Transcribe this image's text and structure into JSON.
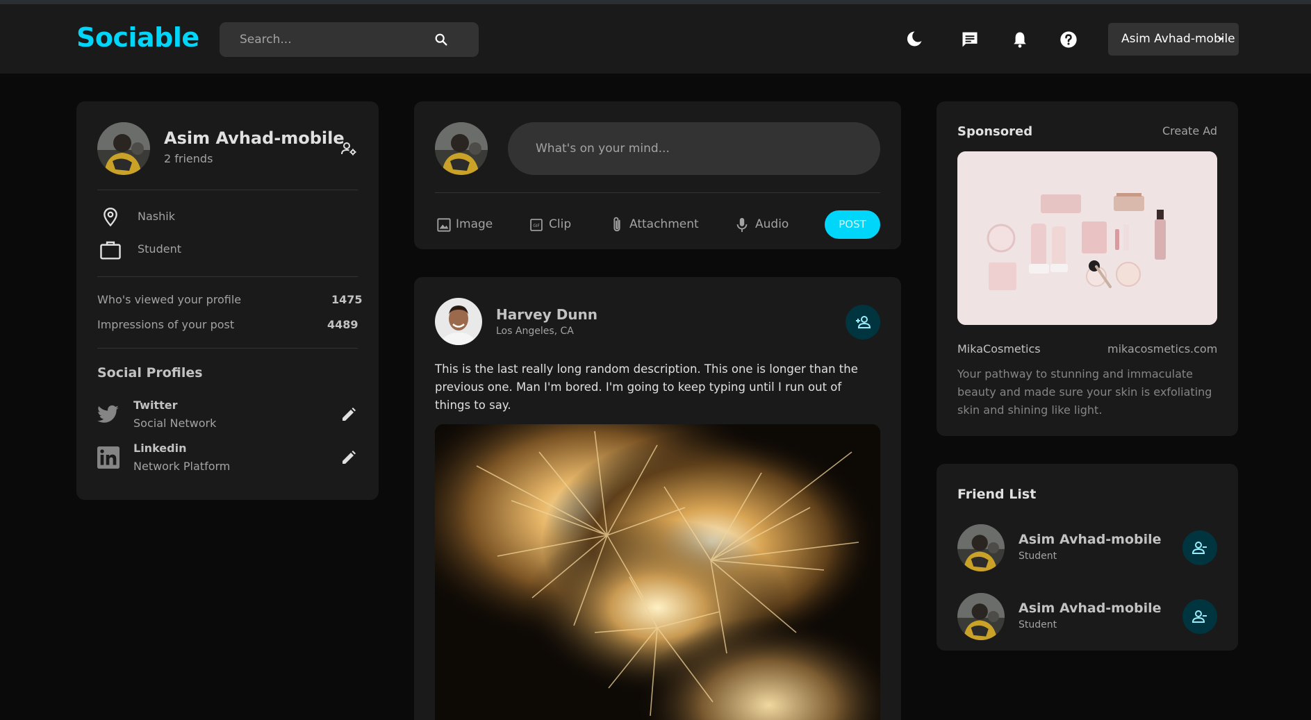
{
  "navbar": {
    "logo": "Sociable",
    "search_placeholder": "Search...",
    "user_name": "Asim Avhad-mobile",
    "icons": [
      "moon-icon",
      "message-icon",
      "bell-icon",
      "help-icon"
    ]
  },
  "profile": {
    "name": "Asim Avhad-mobile",
    "friends": "2 friends",
    "location": "Nashik",
    "occupation": "Student",
    "viewed_label": "Who's viewed your profile",
    "viewed_value": "1475",
    "impressions_label": "Impressions of your post",
    "impressions_value": "4489",
    "social_title": "Social Profiles",
    "socials": [
      {
        "name": "Twitter",
        "desc": "Social Network",
        "icon": "twitter-icon"
      },
      {
        "name": "Linkedin",
        "desc": "Network Platform",
        "icon": "linkedin-icon"
      }
    ]
  },
  "composer": {
    "placeholder": "What's on your mind...",
    "actions": [
      "Image",
      "Clip",
      "Attachment",
      "Audio"
    ],
    "post_label": "POST"
  },
  "post": {
    "author": "Harvey Dunn",
    "location": "Los Angeles, CA",
    "description": "This is the last really long random description. This one is longer than the previous one. Man I'm bored. I'm going to keep typing until I run out of things to say."
  },
  "sponsored": {
    "title": "Sponsored",
    "create_ad": "Create Ad",
    "brand": "MikaCosmetics",
    "url": "mikacosmetics.com",
    "description": "Your pathway to stunning and immaculate beauty and made sure your skin is exfoliating skin and shining like light."
  },
  "friend_list": {
    "title": "Friend List",
    "friends": [
      {
        "name": "Asim Avhad-mobile",
        "sub": "Student"
      },
      {
        "name": "Asim Avhad-mobile",
        "sub": "Student"
      }
    ]
  },
  "colors": {
    "accent": "#00d5fa",
    "background": "#0a0a0a",
    "card": "#1a1a1a",
    "input": "#333333"
  }
}
